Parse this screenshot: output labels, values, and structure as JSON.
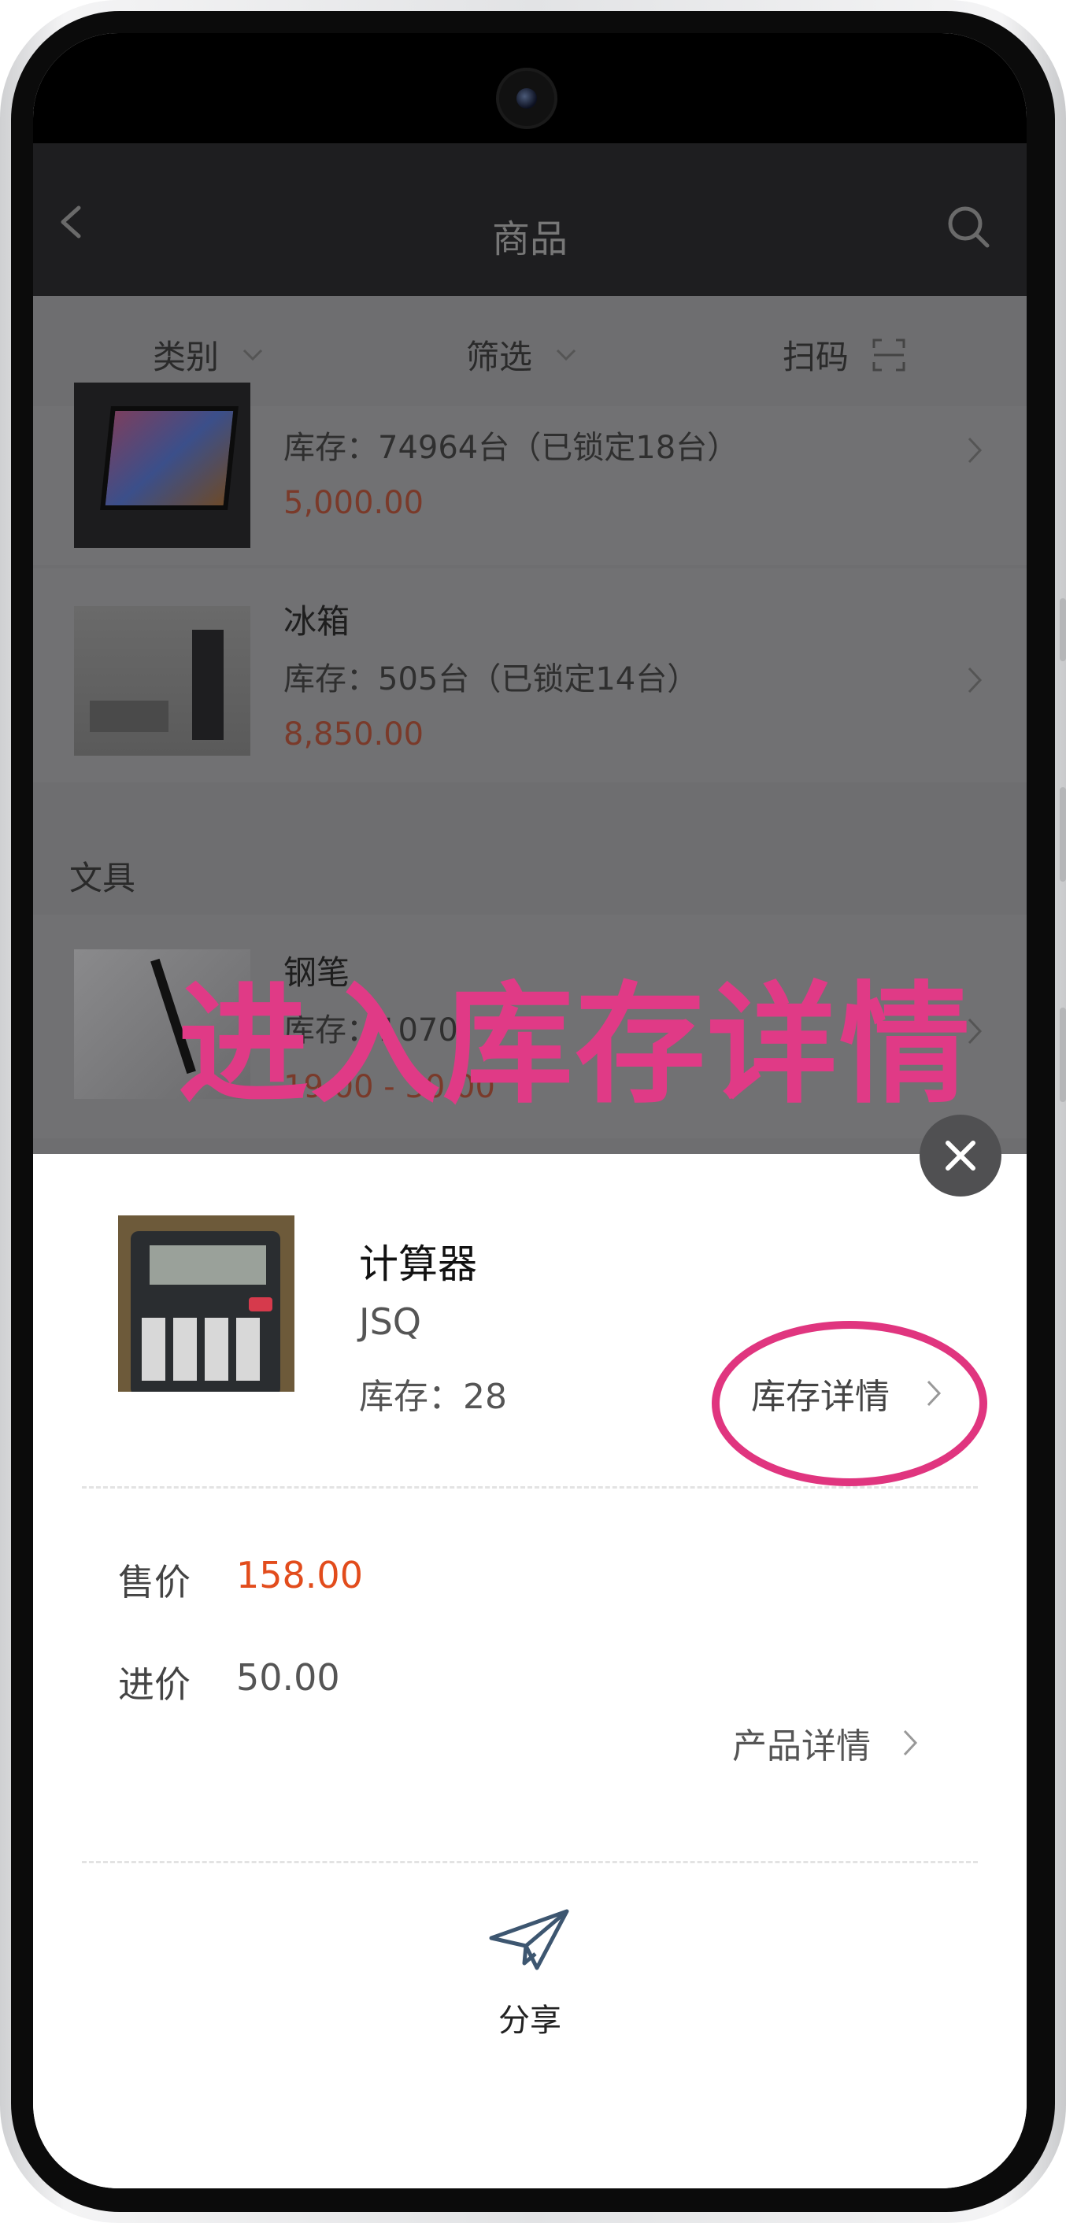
{
  "navbar": {
    "title": "商品",
    "back_icon": "chevron-left-icon",
    "search_icon": "search-icon"
  },
  "filters": {
    "category": "类别",
    "filter": "筛选",
    "scan": "扫码"
  },
  "products": [
    {
      "stock": "库存：74964台（已锁定18台）",
      "price": "5,000.00"
    },
    {
      "name": "冰箱",
      "stock": "库存：505台（已锁定14台）",
      "price": "8,850.00"
    }
  ],
  "section": {
    "title": "文具",
    "item": {
      "name": "钢笔",
      "stock": "库存：1070",
      "price": "19.00 - 30.00"
    }
  },
  "overlay_caption": "进入库存详情",
  "sheet": {
    "name": "计算器",
    "code": "JSQ",
    "stock": "库存：28",
    "stock_detail_label": "库存详情",
    "sale_price_label": "售价",
    "sale_price": "158.00",
    "cost_price_label": "进价",
    "cost_price": "50.00",
    "product_detail_label": "产品详情",
    "share_label": "分享"
  },
  "colors": {
    "accent_red": "#e24c1c",
    "highlight_pink": "#e0357f"
  }
}
